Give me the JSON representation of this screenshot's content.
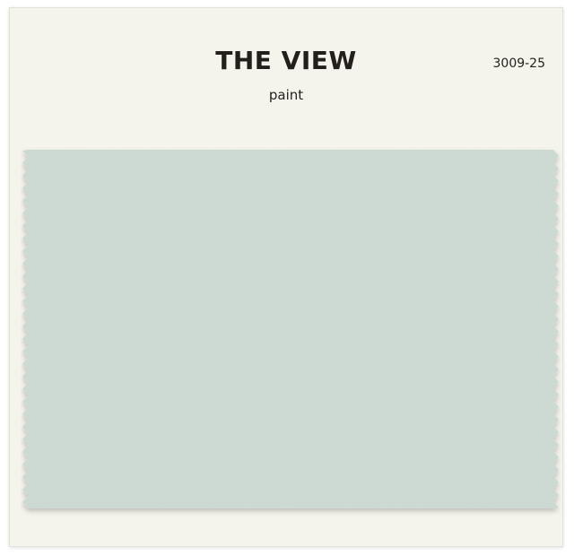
{
  "color_name": "THE VIEW",
  "finish": "paint",
  "color_code": "3009-25",
  "swatch_color": "#cbd9d2",
  "swatch_texture_color": "#dde7e1",
  "card_background": "#f4f4ec"
}
